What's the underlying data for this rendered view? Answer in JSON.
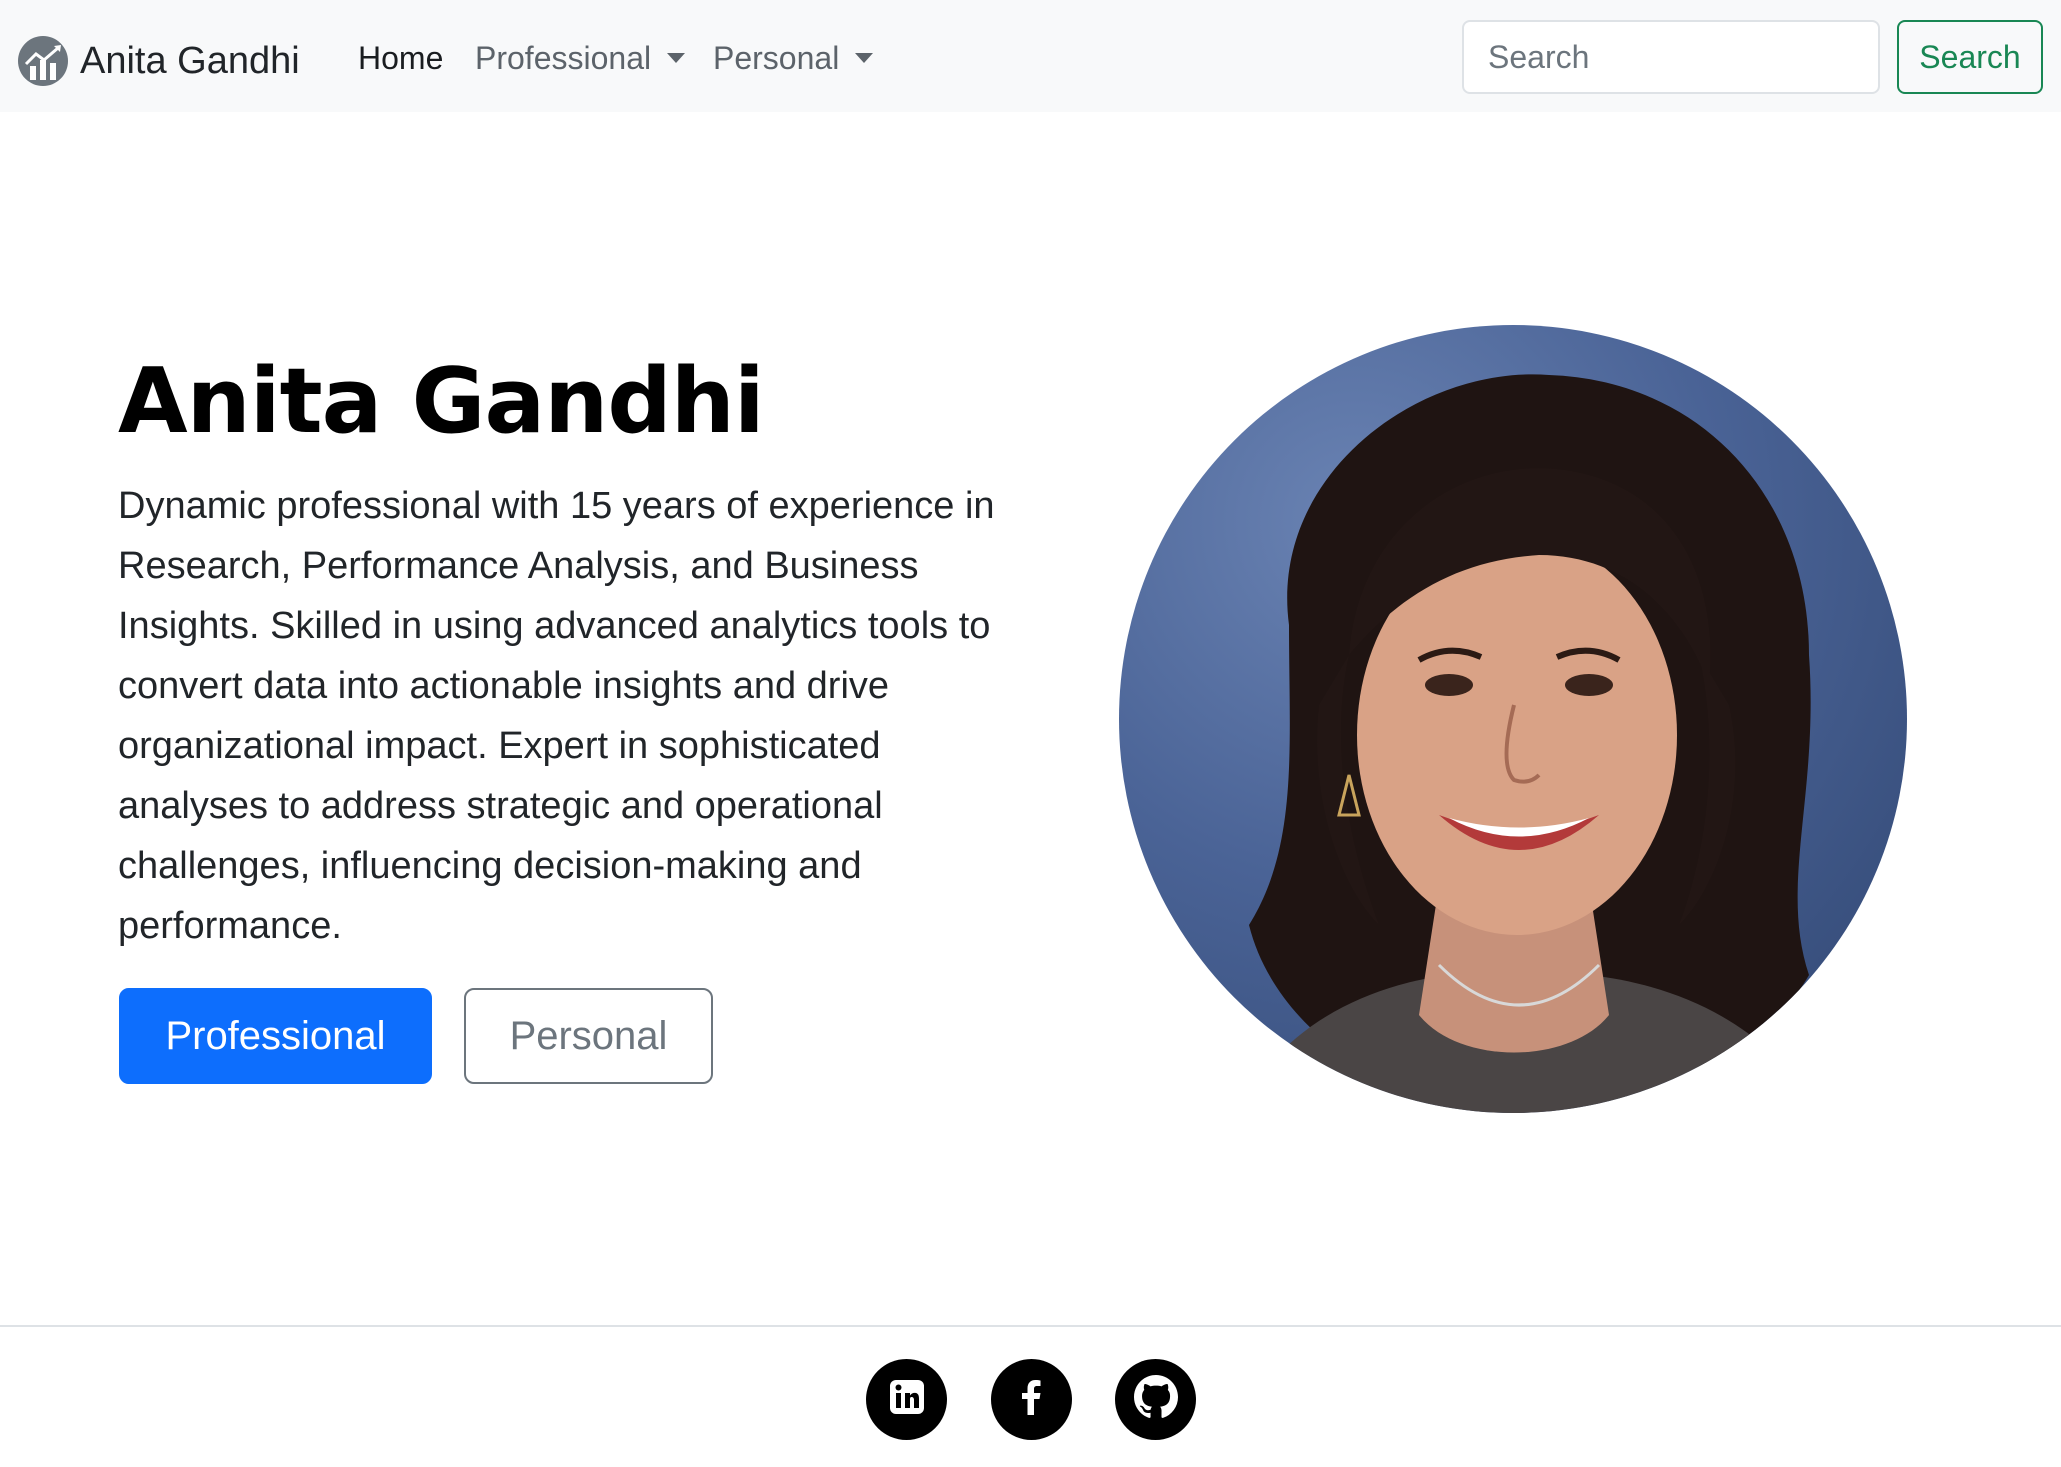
{
  "navbar": {
    "brand": "Anita Gandhi",
    "links": [
      {
        "label": "Home"
      },
      {
        "label": "Professional"
      },
      {
        "label": "Personal"
      }
    ],
    "search": {
      "placeholder": "Search",
      "button_label": "Search"
    }
  },
  "hero": {
    "title": "Anita Gandhi",
    "description": "Dynamic professional with 15 years of experience in Research, Performance Analysis, and Business Insights. Skilled in using advanced analytics tools to convert data into actionable insights and drive organizational impact. Expert in sophisticated analyses to address strategic and operational challenges, influencing decision-making and performance.",
    "buttons": {
      "primary": "Professional",
      "secondary": "Personal"
    }
  },
  "footer": {
    "social": [
      {
        "icon": "linkedin-icon"
      },
      {
        "icon": "facebook-icon"
      },
      {
        "icon": "github-icon"
      }
    ]
  },
  "colors": {
    "primary": "#0d6efd",
    "success": "#198754",
    "navbar_bg": "#f8f9fa",
    "secondary": "#6c757d"
  }
}
